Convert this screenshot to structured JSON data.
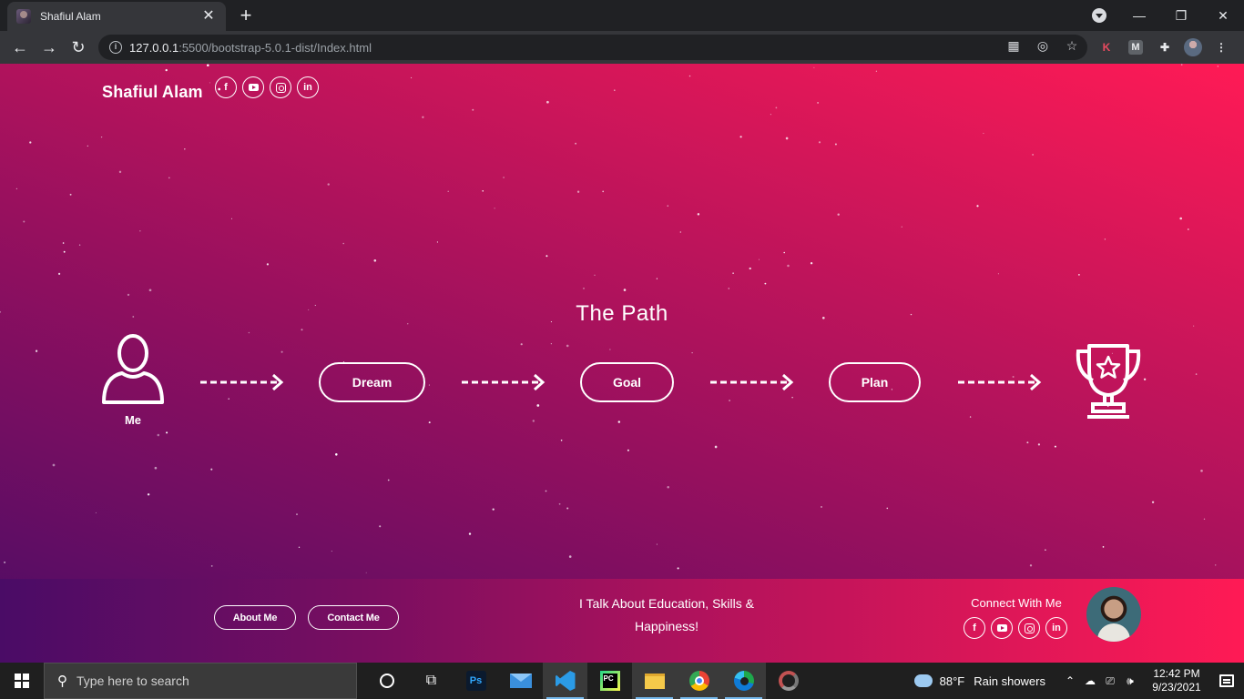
{
  "browser": {
    "tab_title": "Shafiul Alam",
    "tab_close": "✕",
    "new_tab": "+",
    "url_host": "127.0.0.1",
    "url_path": ":5500/bootstrap-5.0.1-dist/Index.html",
    "window_minimize": "—",
    "window_maximize": "❐",
    "window_close": "✕",
    "ext_k": "K",
    "ext_m": "M"
  },
  "page": {
    "brand": "Shafiul Alam",
    "social_facebook": "f",
    "social_linkedin": "in",
    "path_title": "The Path",
    "me_label": "Me",
    "steps": [
      "Dream",
      "Goal",
      "Plan"
    ],
    "footer": {
      "about_button": "About Me",
      "contact_button": "Contact Me",
      "tagline_line1": "I Talk About Education, Skills &",
      "tagline_line2": "Happiness!",
      "connect_heading": "Connect With Me"
    }
  },
  "taskbar": {
    "search_placeholder": "Type here to search",
    "ps_label": "Ps",
    "pc_label": "PC",
    "weather_temp": "88°F",
    "weather_condition": "Rain showers",
    "time": "12:42 PM",
    "date": "9/23/2021"
  }
}
